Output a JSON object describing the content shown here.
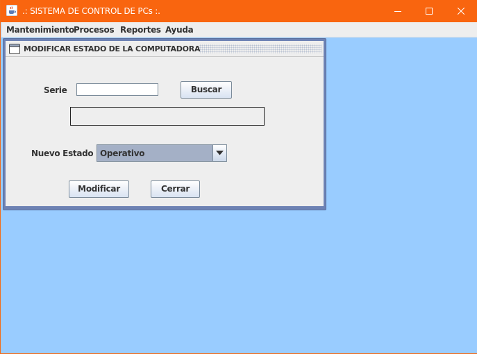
{
  "window": {
    "title": ".: SISTEMA DE CONTROL DE PCs :.",
    "app_icon": "java-cup-icon",
    "controls": [
      "minimize-icon",
      "maximize-icon",
      "close-icon"
    ]
  },
  "menubar": {
    "items": [
      {
        "label": "Mantenimiento"
      },
      {
        "label": "Procesos"
      },
      {
        "label": "Reportes"
      },
      {
        "label": "Ayuda"
      }
    ]
  },
  "internal_frame": {
    "title": "MODIFICAR ESTADO DE LA COMPUTADORA",
    "icon": "window-icon",
    "form": {
      "serie_label": "Serie",
      "serie_value": "",
      "buscar_label": "Buscar",
      "result_text": "",
      "estado_label": "Nuevo Estado",
      "estado_selected": "Operativo",
      "modificar_label": "Modificar",
      "cerrar_label": "Cerrar"
    }
  },
  "colors": {
    "titlebar": "#f9650f",
    "desktop": "#99ccff",
    "frame_border": "#6d82b4",
    "panel": "#eeeeee",
    "combo_bg": "#a4b0c6"
  }
}
